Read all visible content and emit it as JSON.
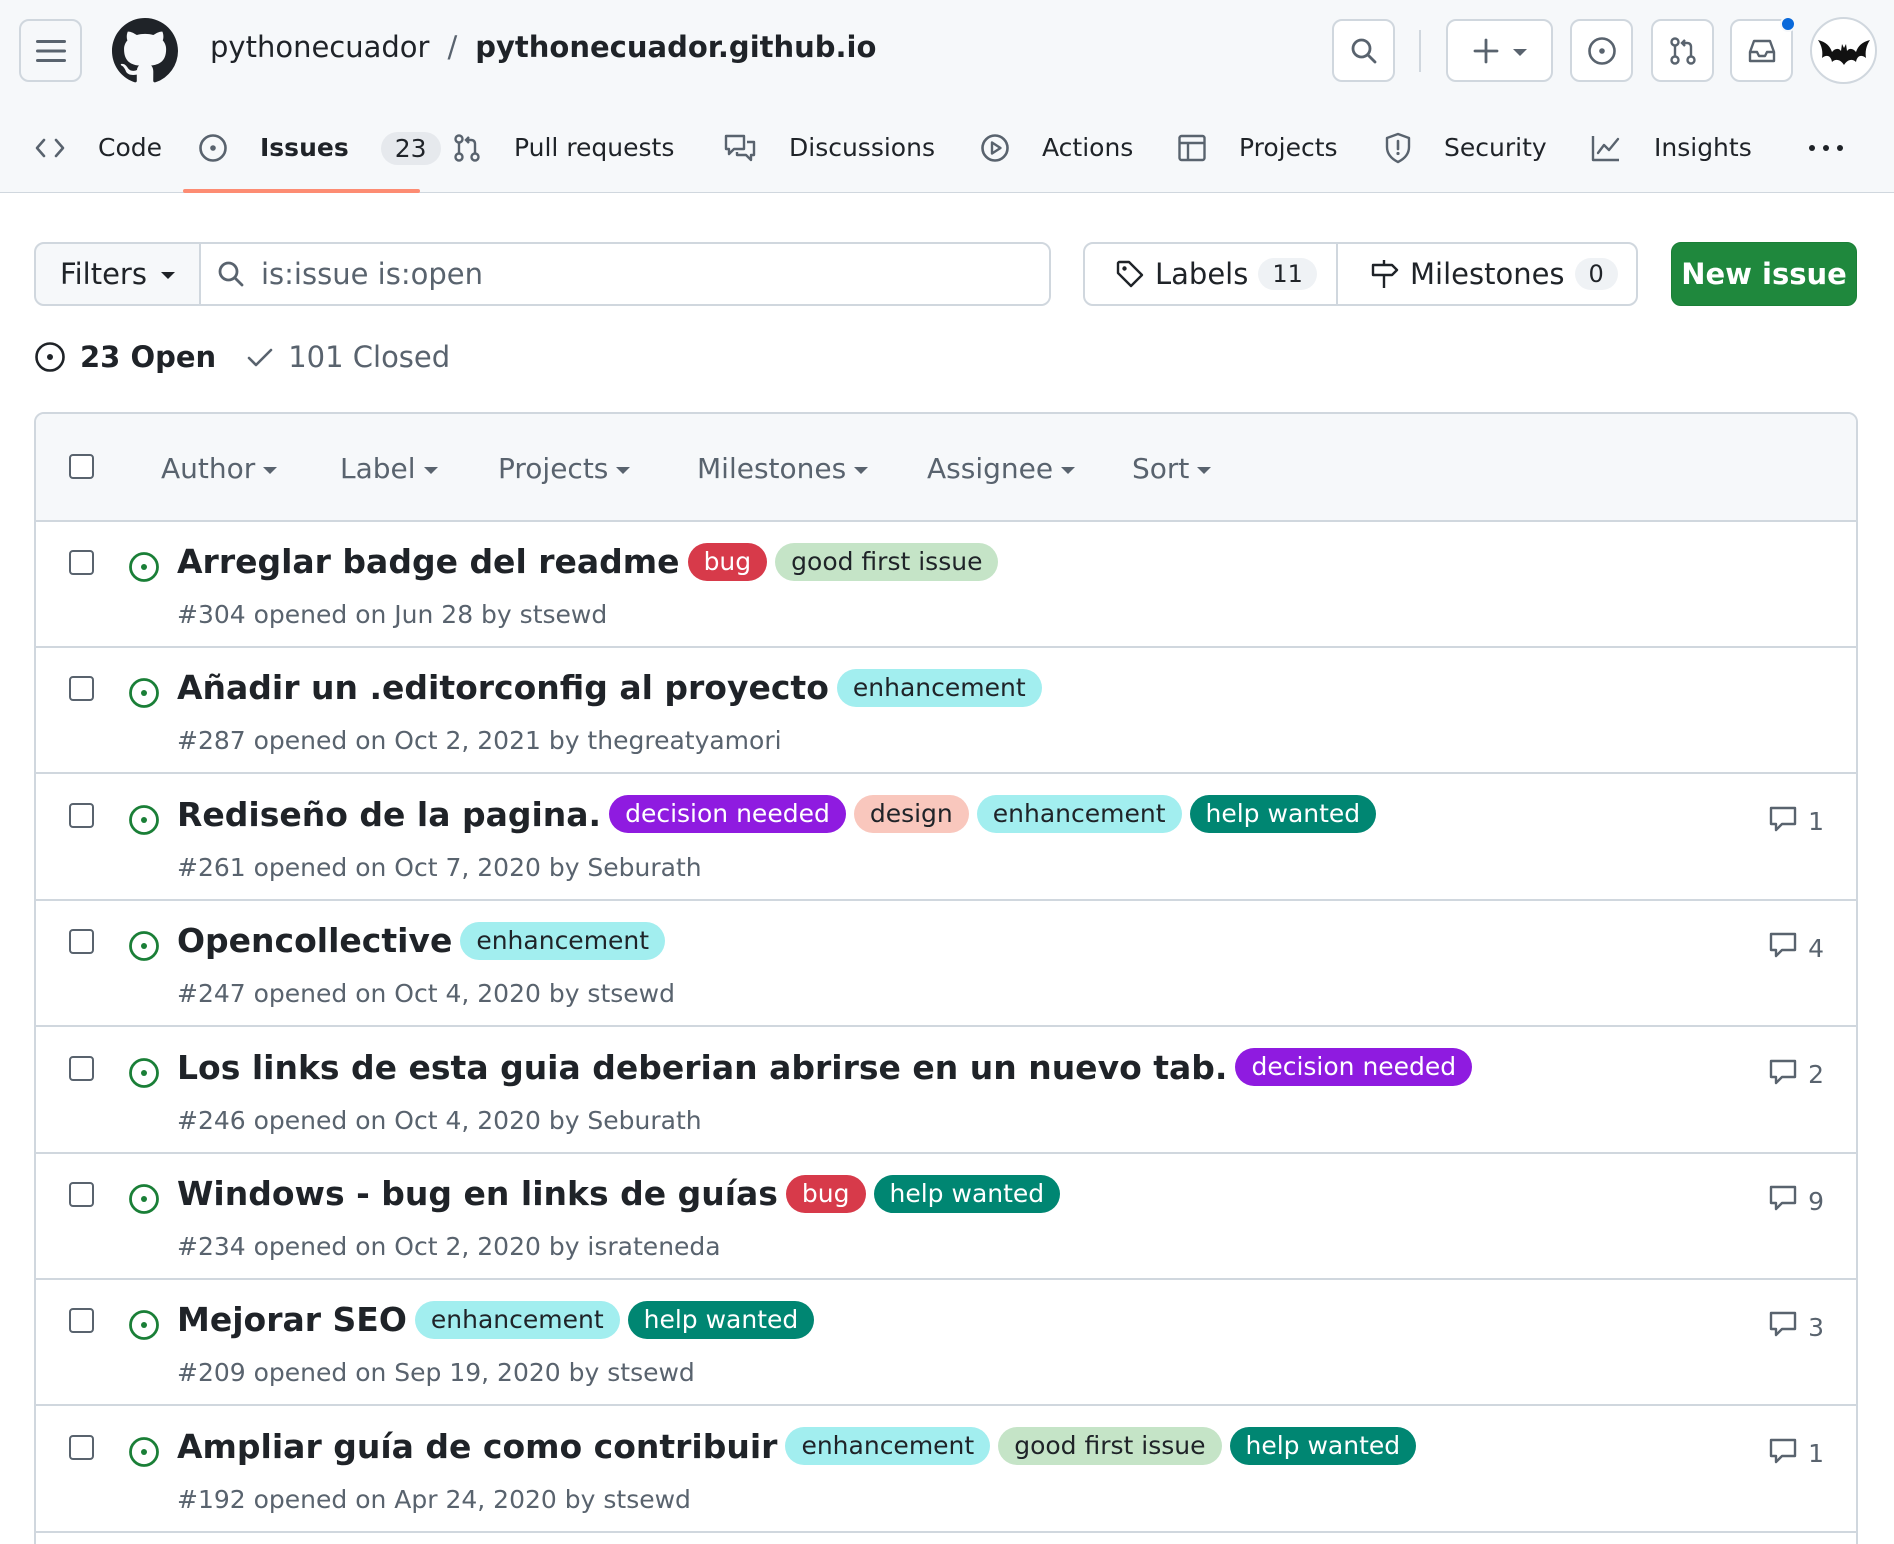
{
  "header": {
    "owner": "pythonecuador",
    "separator": "/",
    "repo": "pythonecuador.github.io"
  },
  "tabs": [
    {
      "label": "Code",
      "icon": "code-icon"
    },
    {
      "label": "Issues",
      "icon": "issue-opened-icon",
      "counter": "23",
      "active": true
    },
    {
      "label": "Pull requests",
      "icon": "git-pull-request-icon"
    },
    {
      "label": "Discussions",
      "icon": "comment-discussion-icon"
    },
    {
      "label": "Actions",
      "icon": "play-icon"
    },
    {
      "label": "Projects",
      "icon": "table-icon"
    },
    {
      "label": "Security",
      "icon": "shield-icon"
    },
    {
      "label": "Insights",
      "icon": "graph-icon"
    }
  ],
  "toolbar": {
    "filters_label": "Filters",
    "search_value": "is:issue is:open",
    "labels_label": "Labels",
    "labels_count": "11",
    "milestones_label": "Milestones",
    "milestones_count": "0",
    "new_issue_label": "New issue"
  },
  "states": {
    "open": "23 Open",
    "closed": "101 Closed"
  },
  "list_filters": [
    "Author",
    "Label",
    "Projects",
    "Milestones",
    "Assignee",
    "Sort"
  ],
  "label_colors": {
    "bug": "#d73a4a",
    "good first issue": "#c5e4c7",
    "enhancement": "#a2eeef",
    "decision needed": "#8f1be0",
    "design": "#f9c7bd",
    "help wanted": "#008672"
  },
  "issues": [
    {
      "title": "Arreglar badge del readme",
      "labels": [
        "bug",
        "good first issue"
      ],
      "meta": "#304 opened on Jun 28 by stsewd",
      "comments": ""
    },
    {
      "title": "Añadir un .editorconfig al proyecto",
      "labels": [
        "enhancement"
      ],
      "meta": "#287 opened on Oct 2, 2021 by thegreatyamori",
      "comments": ""
    },
    {
      "title": "Rediseño de la pagina.",
      "labels": [
        "decision needed",
        "design",
        "enhancement",
        "help wanted"
      ],
      "meta": "#261 opened on Oct 7, 2020 by Seburath",
      "comments": "1"
    },
    {
      "title": "Opencollective",
      "labels": [
        "enhancement"
      ],
      "meta": "#247 opened on Oct 4, 2020 by stsewd",
      "comments": "4"
    },
    {
      "title": "Los links de esta guia deberian abrirse en un nuevo tab.",
      "labels": [
        "decision needed"
      ],
      "meta": "#246 opened on Oct 4, 2020 by Seburath",
      "comments": "2"
    },
    {
      "title": "Windows - bug en links de guías",
      "labels": [
        "bug",
        "help wanted"
      ],
      "meta": "#234 opened on Oct 2, 2020 by israteneda",
      "comments": "9"
    },
    {
      "title": "Mejorar SEO",
      "labels": [
        "enhancement",
        "help wanted"
      ],
      "meta": "#209 opened on Sep 19, 2020 by stsewd",
      "comments": "3"
    },
    {
      "title": "Ampliar guía de como contribuir",
      "labels": [
        "enhancement",
        "good first issue",
        "help wanted"
      ],
      "meta": "#192 opened on Apr 24, 2020 by stsewd",
      "comments": "1"
    }
  ]
}
